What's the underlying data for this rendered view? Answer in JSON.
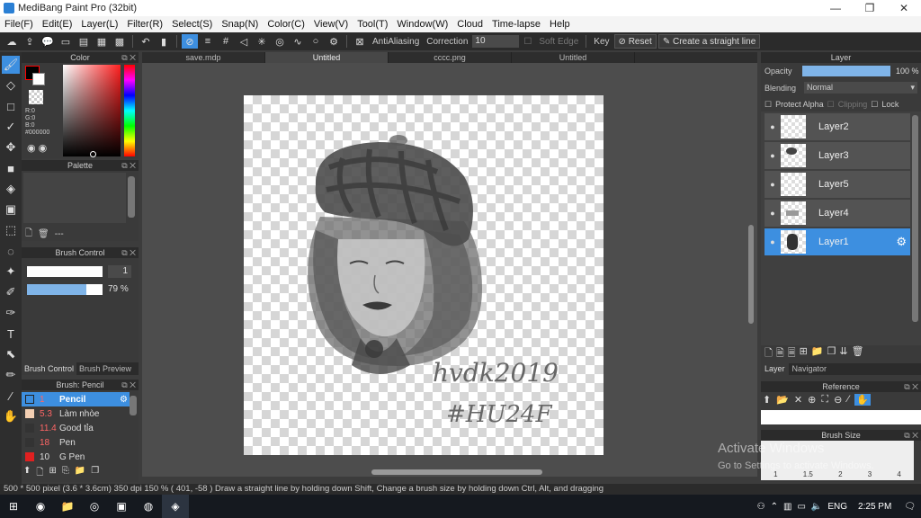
{
  "window": {
    "title": "MediBang Paint Pro (32bit)"
  },
  "menu": [
    "File(F)",
    "Edit(E)",
    "Layer(L)",
    "Filter(R)",
    "Select(S)",
    "Snap(N)",
    "Color(C)",
    "View(V)",
    "Tool(T)",
    "Window(W)",
    "Cloud",
    "Time-lapse",
    "Help"
  ],
  "toolbar": {
    "antialiasing": "AntiAliasing",
    "correction_label": "Correction",
    "correction_value": "10",
    "soft_edge": "Soft Edge",
    "key": "Key",
    "reset": "Reset",
    "straight_line": "Create a straight line"
  },
  "color_panel": {
    "title": "Color",
    "r": "R:0",
    "g": "G:0",
    "b": "B:0",
    "hex": "#000000",
    "foreground": "#000000",
    "background": "#ffffff"
  },
  "palette_panel": {
    "title": "Palette",
    "placeholder": "---"
  },
  "brush_control": {
    "title": "Brush Control",
    "size_value": "1",
    "opacity_value": "79 %",
    "opacity_fraction": 0.79
  },
  "brush_tabs": [
    "Brush Control",
    "Brush Preview"
  ],
  "brush_list": {
    "title": "Brush: Pencil",
    "items": [
      {
        "size": "1",
        "name": "Pencil",
        "color": "#3d8fe0",
        "selected": true
      },
      {
        "size": "5.3",
        "name": "Làm nhòe",
        "color": "#f3cfb3"
      },
      {
        "size": "11.4",
        "name": "Good tỉa",
        "color": "#333333"
      },
      {
        "size": "18",
        "name": "Pen",
        "color": "#333333"
      },
      {
        "size": "10",
        "name": "G Pen",
        "color": "#e02020"
      }
    ]
  },
  "tabs": [
    "save.mdp",
    "Untitled",
    "cccc.png",
    "Untitled"
  ],
  "active_tab": 1,
  "canvas": {
    "signature_line1": "hvdk2019",
    "signature_line2": "#HU24F"
  },
  "layer_panel": {
    "title": "Layer",
    "opacity_label": "Opacity",
    "opacity_value": "100 %",
    "blending_label": "Blending",
    "blending_value": "Normal",
    "protect_alpha": "Protect Alpha",
    "clipping": "Clipping",
    "lock": "Lock",
    "layers": [
      "Layer2",
      "Layer3",
      "Layer5",
      "Layer4",
      "Layer1"
    ],
    "selected_layer": "Layer1"
  },
  "right_tabs": [
    "Layer",
    "Navigator"
  ],
  "reference_panel": {
    "title": "Reference"
  },
  "brush_size_panel": {
    "title": "Brush Size",
    "sizes": [
      "1",
      "1.5",
      "2",
      "3",
      "4"
    ]
  },
  "watermark": {
    "line1": "Activate Windows",
    "line2": "Go to Settings to activate Windows."
  },
  "status": {
    "size": "500 * 500 pixel",
    "cm": "(3.6 * 3.6cm)",
    "dpi": "350 dpi",
    "zoom": "150 %",
    "coords": "( 401, -58 )",
    "hint": "Draw a straight line by holding down Shift, Change a brush size by holding down Ctrl, Alt, and dragging"
  },
  "taskbar": {
    "lang": "ENG",
    "time": "2:25 PM"
  }
}
